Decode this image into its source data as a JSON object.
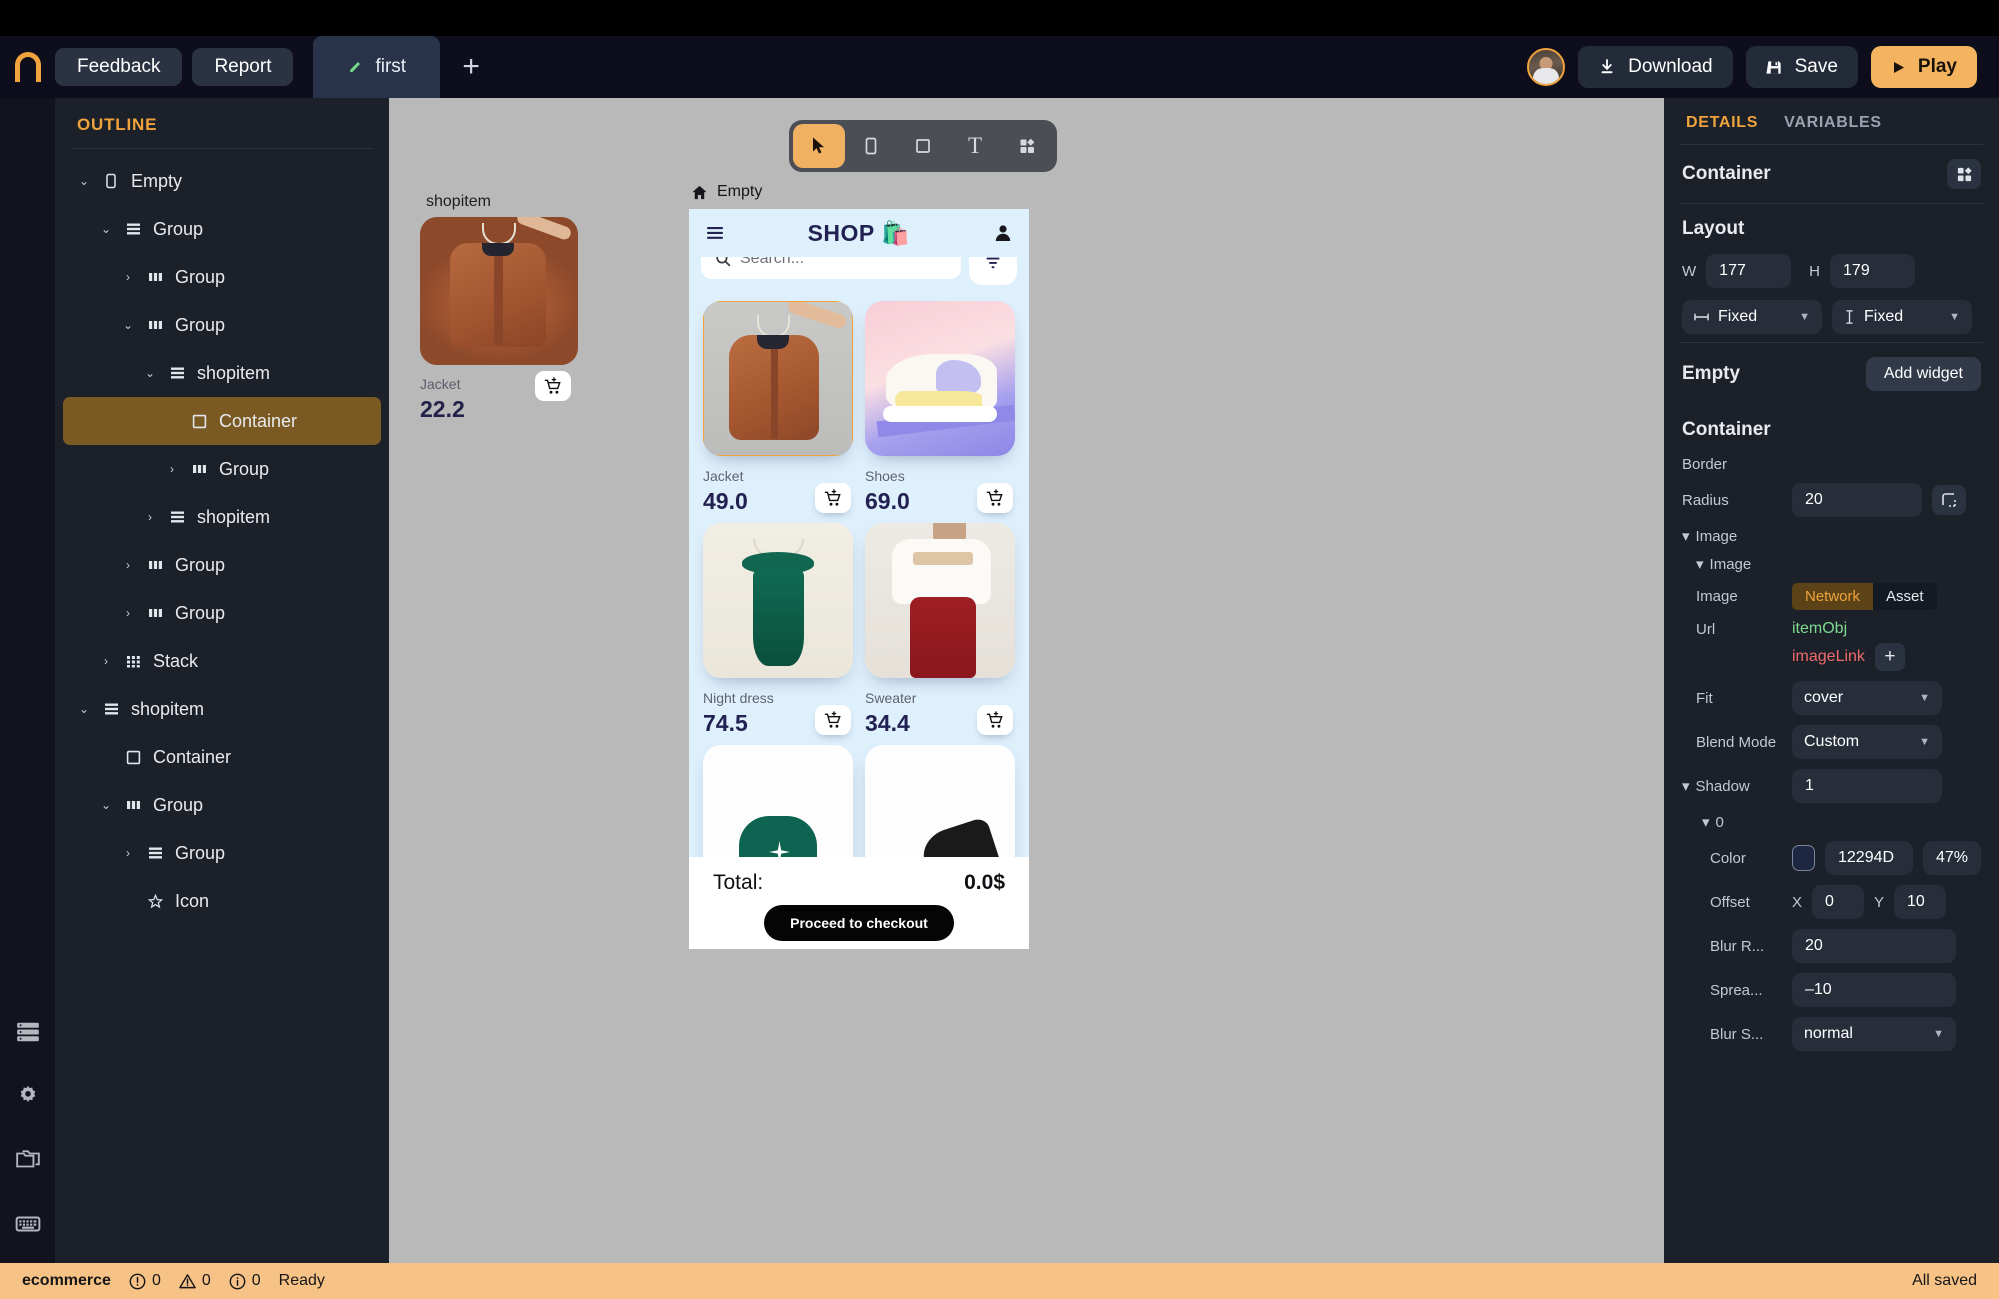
{
  "topbar": {
    "logo": "logo-n-icon",
    "buttons": [
      {
        "label": "Feedback",
        "name": "feedback-button"
      },
      {
        "label": "Report",
        "name": "report-button"
      }
    ],
    "tab": {
      "label": "first",
      "icon": "brush-icon"
    },
    "add_tab": "+",
    "download_label": "Download",
    "save_label": "Save",
    "play_label": "Play"
  },
  "rail": {
    "items": [
      "layers-icon",
      "gear-icon",
      "folder-icon",
      "keyboard-icon"
    ]
  },
  "outline": {
    "title": "OUTLINE",
    "items": [
      {
        "label": "Empty",
        "indent": 0,
        "caret": "down",
        "icon": "device-icon",
        "selected": false
      },
      {
        "label": "Group",
        "indent": 1,
        "caret": "down",
        "icon": "rows-icon",
        "selected": false
      },
      {
        "label": "Group",
        "indent": 2,
        "caret": "right",
        "icon": "columns-icon",
        "selected": false
      },
      {
        "label": "Group",
        "indent": 2,
        "caret": "down",
        "icon": "columns-icon",
        "selected": false
      },
      {
        "label": "shopitem",
        "indent": 3,
        "caret": "down",
        "icon": "rows-icon",
        "selected": false
      },
      {
        "label": "Container",
        "indent": 4,
        "caret": "none",
        "icon": "square-icon",
        "selected": true
      },
      {
        "label": "Group",
        "indent": 4,
        "caret": "right",
        "icon": "columns-icon",
        "selected": false
      },
      {
        "label": "shopitem",
        "indent": 3,
        "caret": "right",
        "icon": "rows-icon",
        "selected": false
      },
      {
        "label": "Group",
        "indent": 2,
        "caret": "right",
        "icon": "columns-icon",
        "selected": false
      },
      {
        "label": "Group",
        "indent": 2,
        "caret": "right",
        "icon": "columns-icon",
        "selected": false
      },
      {
        "label": "Stack",
        "indent": 1,
        "caret": "right",
        "icon": "grid-icon",
        "selected": false
      },
      {
        "label": "shopitem",
        "indent": 0,
        "caret": "down",
        "icon": "rows-icon",
        "selected": false
      },
      {
        "label": "Container",
        "indent": 1,
        "caret": "none",
        "icon": "square-icon",
        "selected": false
      },
      {
        "label": "Group",
        "indent": 1,
        "caret": "down",
        "icon": "columns-icon",
        "selected": false
      },
      {
        "label": "Group",
        "indent": 2,
        "caret": "right",
        "icon": "rows-icon",
        "selected": false
      },
      {
        "label": "Icon",
        "indent": 2,
        "caret": "none",
        "icon": "star-icon",
        "selected": false
      }
    ]
  },
  "canvas": {
    "tools": [
      {
        "name": "select-tool",
        "glyph": "cursor",
        "active": true
      },
      {
        "name": "device-tool",
        "glyph": "device",
        "active": false
      },
      {
        "name": "container-tool",
        "glyph": "square",
        "active": false
      },
      {
        "name": "text-tool",
        "glyph": "T",
        "active": false
      },
      {
        "name": "widget-tool",
        "glyph": "widgets",
        "active": false
      }
    ],
    "preview": {
      "label": "shopitem",
      "name": "Jacket",
      "price": "22.2",
      "cart_icon": "add-to-cart-icon"
    },
    "device": {
      "frame_label": "Empty",
      "frame_icon": "home-icon",
      "app": {
        "title": "SHOP",
        "title_emoji": "🛍️",
        "menu_icon": "hamburger-icon",
        "profile_icon": "person-icon",
        "search_placeholder": "Search...",
        "search_icon": "search-icon",
        "filter_icon": "filter-icon",
        "products": [
          {
            "name": "Jacket",
            "price": "49.0",
            "selected": true
          },
          {
            "name": "Shoes",
            "price": "69.0",
            "selected": false
          },
          {
            "name": "Night dress",
            "price": "74.5",
            "selected": false
          },
          {
            "name": "Sweater",
            "price": "34.4",
            "selected": false
          }
        ],
        "checkout": {
          "total_label": "Total:",
          "total_amount": "0.0$",
          "button_label": "Proceed to checkout"
        }
      }
    }
  },
  "details": {
    "tabs": [
      {
        "label": "DETAILS",
        "active": true
      },
      {
        "label": "VARIABLES",
        "active": false
      }
    ],
    "node_title": "Container",
    "node_icon": "widgets-icon",
    "layout": {
      "title": "Layout",
      "w_label": "W",
      "w_value": "177",
      "h_label": "H",
      "h_value": "179",
      "w_mode": "Fixed",
      "h_mode": "Fixed",
      "w_mode_icon": "horizontal-resize-icon",
      "h_mode_icon": "vertical-resize-icon"
    },
    "empty_row": {
      "label": "Empty",
      "button": "Add widget"
    },
    "container": {
      "title": "Container",
      "border_label": "Border",
      "radius_label": "Radius",
      "radius_value": "20",
      "radius_icon": "corner-radius-icon",
      "image_group_label": "Image",
      "image_sub_label": "Image",
      "image_label": "Image",
      "source_options": [
        "Network",
        "Asset"
      ],
      "source_selected": "Network",
      "url_label": "Url",
      "url_var1": "itemObj",
      "url_var2": "imageLink",
      "url_add": "+",
      "fit_label": "Fit",
      "fit_value": "cover",
      "blend_label": "Blend Mode",
      "blend_value": "Custom",
      "shadow_label": "Shadow",
      "shadow_count": "1",
      "shadow_index": "0",
      "color_label": "Color",
      "color_hex": "12294D",
      "color_opacity": "47%",
      "color_swatch": "#12294D",
      "offset_label": "Offset",
      "offset_x_label": "X",
      "offset_x": "0",
      "offset_y_label": "Y",
      "offset_y": "10",
      "blur_radius_label": "Blur R...",
      "blur_radius": "20",
      "spread_label": "Sprea...",
      "spread": "–10",
      "blur_style_label": "Blur S...",
      "blur_style": "normal"
    }
  },
  "status": {
    "project": "ecommerce",
    "errors": "0",
    "warnings": "0",
    "infos": "0",
    "state": "Ready",
    "saved": "All saved"
  }
}
